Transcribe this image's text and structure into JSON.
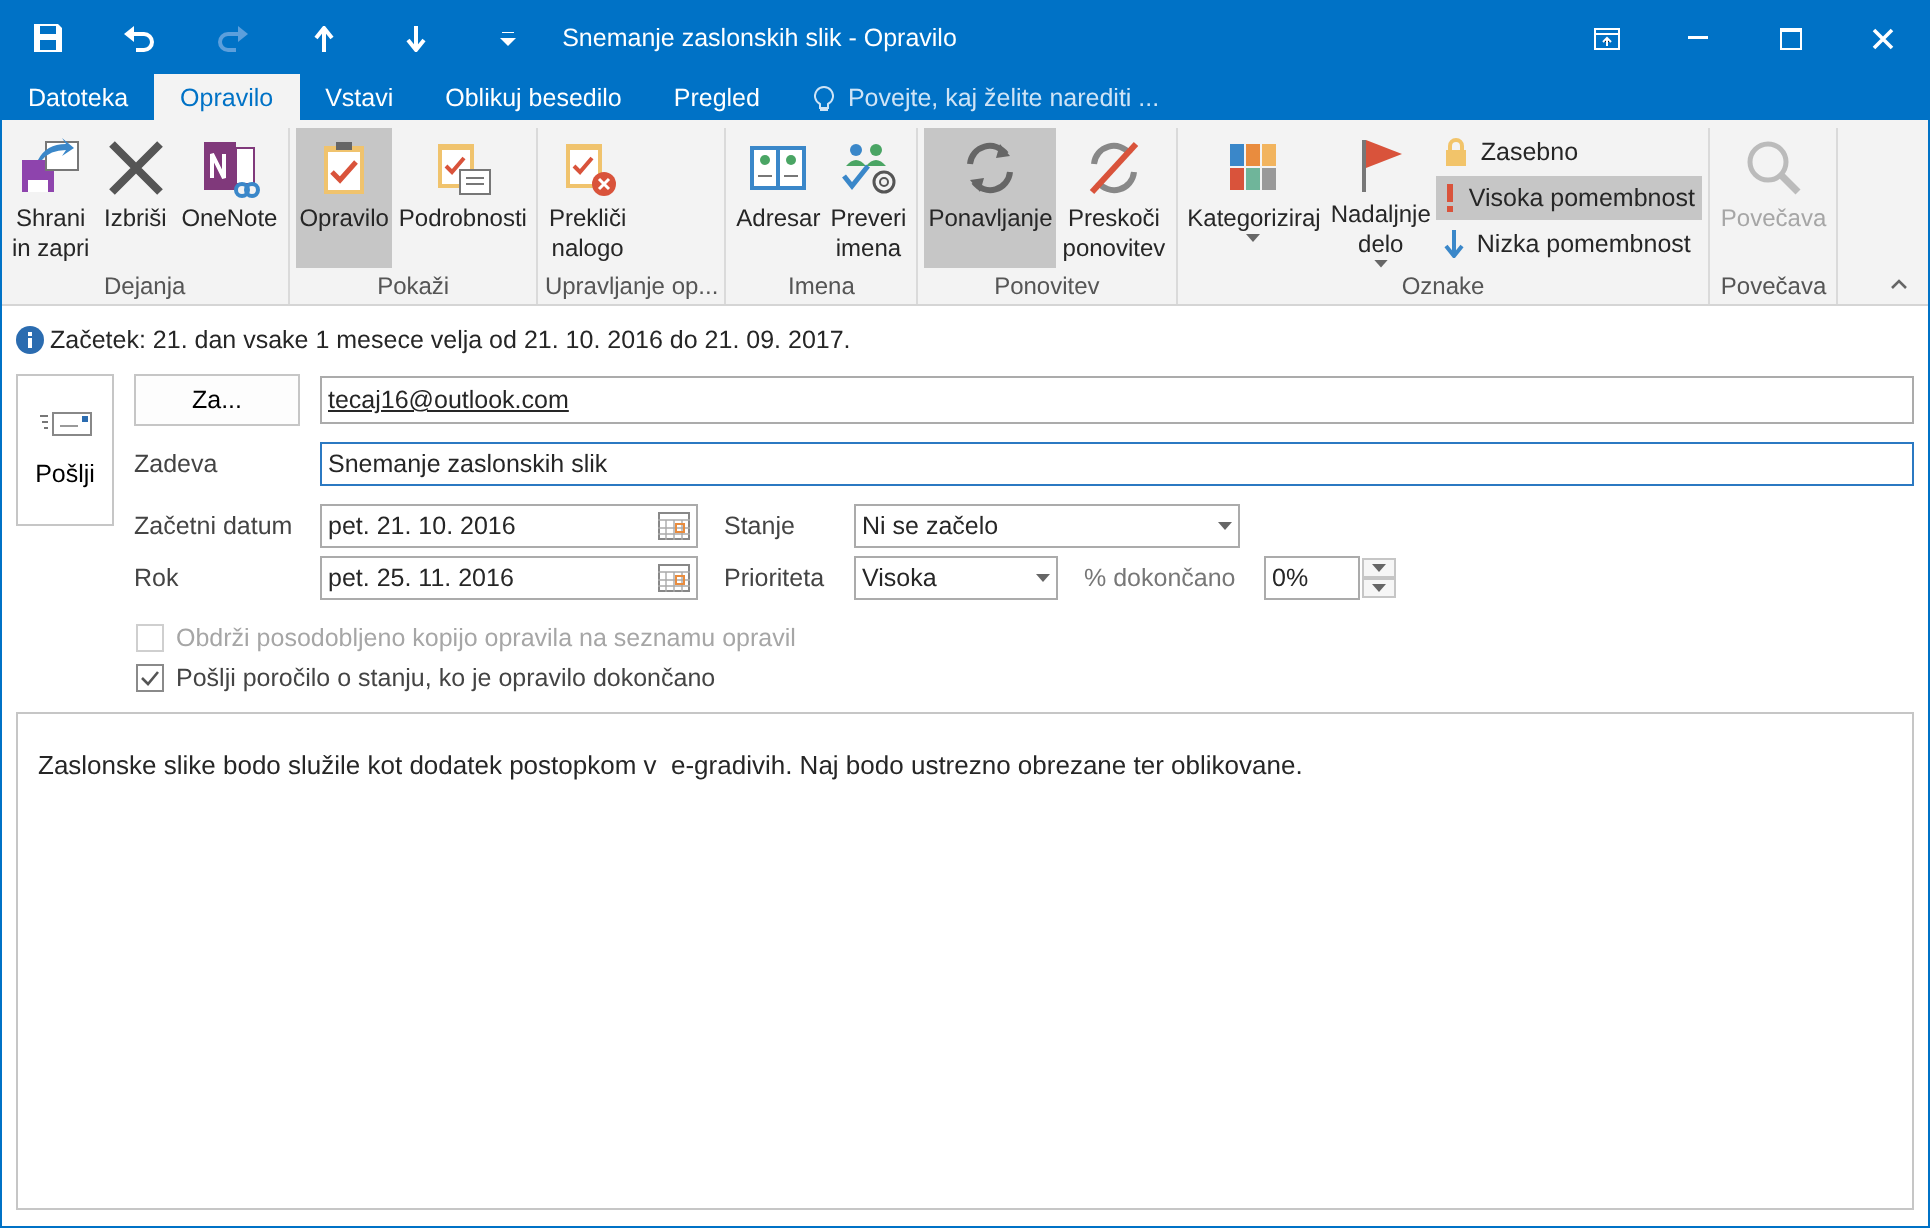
{
  "window": {
    "title": "Snemanje zaslonskih slik - Opravilo"
  },
  "tabs": [
    {
      "label": "Datoteka",
      "selected": false
    },
    {
      "label": "Opravilo",
      "selected": true
    },
    {
      "label": "Vstavi",
      "selected": false
    },
    {
      "label": "Oblikuj besedilo",
      "selected": false
    },
    {
      "label": "Pregled",
      "selected": false
    }
  ],
  "tell_me": {
    "placeholder": "Povejte, kaj želite narediti ..."
  },
  "ribbon": {
    "groups": [
      {
        "label": "Dejanja",
        "items": [
          {
            "kind": "large",
            "label": "Shrani in zapri",
            "selected": false,
            "disabled": false
          },
          {
            "kind": "large",
            "label": "Izbriši",
            "selected": false,
            "disabled": false
          },
          {
            "kind": "large",
            "label": "OneNote",
            "selected": false,
            "disabled": false
          }
        ]
      },
      {
        "label": "Pokaži",
        "items": [
          {
            "kind": "large",
            "label": "Opravilo",
            "selected": true,
            "disabled": false
          },
          {
            "kind": "large",
            "label": "Podrobnosti",
            "selected": false,
            "disabled": false
          }
        ]
      },
      {
        "label": "Upravljanje op...",
        "items": [
          {
            "kind": "large",
            "label": "Prekliči nalogo",
            "selected": false,
            "disabled": false
          }
        ]
      },
      {
        "label": "Imena",
        "items": [
          {
            "kind": "large",
            "label": "Adresar",
            "selected": false,
            "disabled": false
          },
          {
            "kind": "large",
            "label": "Preveri imena",
            "selected": false,
            "disabled": false
          }
        ]
      },
      {
        "label": "Ponovitev",
        "items": [
          {
            "kind": "large",
            "label": "Ponavljanje",
            "selected": true,
            "disabled": false
          },
          {
            "kind": "large",
            "label": "Preskoči ponovitev",
            "selected": false,
            "disabled": false
          }
        ]
      },
      {
        "label": "Oznake",
        "items": [
          {
            "kind": "dropdown",
            "label": "Kategoriziraj",
            "selected": false,
            "disabled": false
          },
          {
            "kind": "dropdown",
            "label": "Nadaljnje delo",
            "selected": false,
            "disabled": false
          },
          {
            "kind": "small",
            "label": "Zasebno",
            "selected": false,
            "disabled": false
          },
          {
            "kind": "small",
            "label": "Visoka pomembnost",
            "selected": true,
            "disabled": false
          },
          {
            "kind": "small",
            "label": "Nizka pomembnost",
            "selected": false,
            "disabled": false
          }
        ]
      },
      {
        "label": "Povečava",
        "items": [
          {
            "kind": "large",
            "label": "Povečava",
            "selected": false,
            "disabled": true
          }
        ]
      }
    ]
  },
  "info": "Začetek: 21. dan vsake 1 mesece velja od 21. 10. 2016 do 21. 09. 2017.",
  "send_button": "Pošlji",
  "to_button": "Za...",
  "to_value": "tecaj16@outlook.com",
  "subject": {
    "label": "Zadeva",
    "value": "Snemanje zaslonskih slik"
  },
  "start_date": {
    "label": "Začetni datum",
    "value": "pet. 21. 10. 2016"
  },
  "due_date": {
    "label": "Rok",
    "value": "pet. 25. 11. 2016"
  },
  "status": {
    "label": "Stanje",
    "value": "Ni se začelo"
  },
  "priority": {
    "label": "Prioriteta",
    "value": "Visoka"
  },
  "percent": {
    "label": "% dokončano",
    "value": "0%"
  },
  "checkboxes": [
    {
      "label": "Obdrži posodobljeno kopijo opravila na seznamu opravil",
      "checked": false,
      "disabled": true
    },
    {
      "label": "Pošlji poročilo o stanju, ko je opravilo dokončano",
      "checked": true,
      "disabled": false
    }
  ],
  "body": "Zaslonske slike bodo služile kot dodatek postopkom v  e-gradivih. Naj bodo ustrezno obrezane ter oblikovane."
}
